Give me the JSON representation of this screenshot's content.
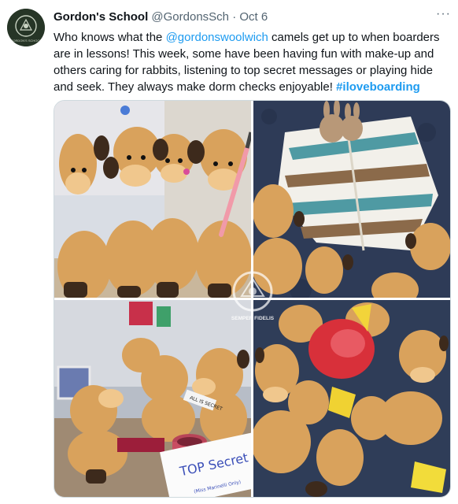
{
  "tweet": {
    "author_name": "Gordon's School",
    "author_handle": "@GordonsSch",
    "separator": "·",
    "date": "Oct 6",
    "more_glyph": "···",
    "avatar_text": "GORDON'S SCHOOL",
    "text_before_mention": "Who knows what the ",
    "mention": "@gordonswoolwich",
    "text_after_mention": " camels get up to when boarders are in lessons! This week, some have been having fun with make-up and others caring for rabbits, listening to top secret messages or playing hide and seek. They always make dorm checks enjoyable! ",
    "hashtag": "#iloveboarding"
  },
  "media": {
    "photos": [
      {
        "subject": "camels-with-makeup"
      },
      {
        "subject": "camels-with-rabbits"
      },
      {
        "subject": "camels-top-secret"
      },
      {
        "subject": "camels-hide-and-seek"
      }
    ],
    "watermark_text": "SEMPER FIDELIS",
    "note_text": "TOP Secret",
    "note_small": "(Miss Marinelli Only)",
    "speaker_label": "ALL IS SECRET"
  },
  "colors": {
    "link": "#1d9bf0",
    "text": "#0f1419",
    "secondary": "#536471",
    "border": "#cfd9de"
  }
}
